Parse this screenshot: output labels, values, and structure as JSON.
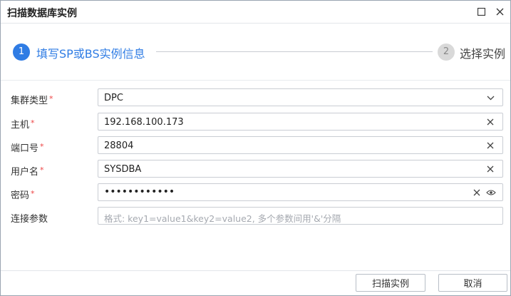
{
  "window": {
    "title": "扫描数据库实例"
  },
  "steps": [
    {
      "number": "1",
      "label": "填写SP或BS实例信息",
      "active": true
    },
    {
      "number": "2",
      "label": "选择实例",
      "active": false
    }
  ],
  "form": {
    "required_mark": "*",
    "cluster_type": {
      "label": "集群类型",
      "value": "DPC",
      "icon": "chevron-down-icon"
    },
    "host": {
      "label": "主机",
      "value": "192.168.100.173",
      "icon": "clear-icon"
    },
    "port": {
      "label": "端口号",
      "value": "28804",
      "icon": "clear-icon"
    },
    "username": {
      "label": "用户名",
      "value": "SYSDBA",
      "icon": "clear-icon"
    },
    "password": {
      "label": "密码",
      "value": "••••••••••••",
      "icons": [
        "clear-icon",
        "eye-icon"
      ]
    },
    "params": {
      "label": "连接参数",
      "value": "",
      "placeholder": "格式: key1=value1&key2=value2, 多个参数间用'&'分隔"
    }
  },
  "footer": {
    "scan_label": "扫描实例",
    "cancel_label": "取消"
  },
  "colors": {
    "accent": "#2f7ce4",
    "required": "#e44444",
    "inactive_step": "#d9d9d9"
  }
}
